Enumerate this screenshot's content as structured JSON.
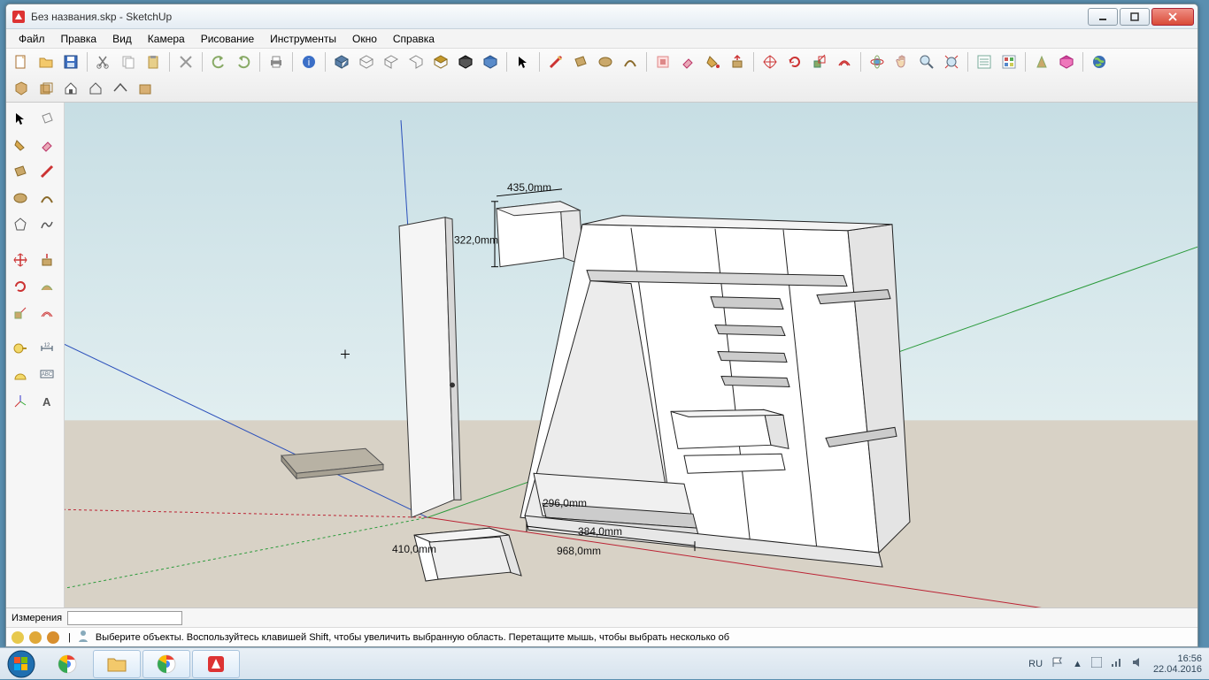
{
  "title": "Без названия.skp - SketchUp",
  "menu": [
    "Файл",
    "Правка",
    "Вид",
    "Камера",
    "Рисование",
    "Инструменты",
    "Окно",
    "Справка"
  ],
  "status": {
    "measure_label": "Измерения",
    "measure_value": "",
    "hint": "Выберите объекты. Воспользуйтесь клавишей Shift, чтобы увеличить выбранную область. Перетащите мышь, чтобы выбрать несколько об"
  },
  "dimensions": {
    "d1": "435,0mm",
    "d2": "322,0mm",
    "d3": "296,0mm",
    "d4": "384,0mm",
    "d5": "968,0mm",
    "d6": "410,0mm"
  },
  "tray": {
    "lang": "RU",
    "time": "16:56",
    "date": "22.04.2016"
  }
}
